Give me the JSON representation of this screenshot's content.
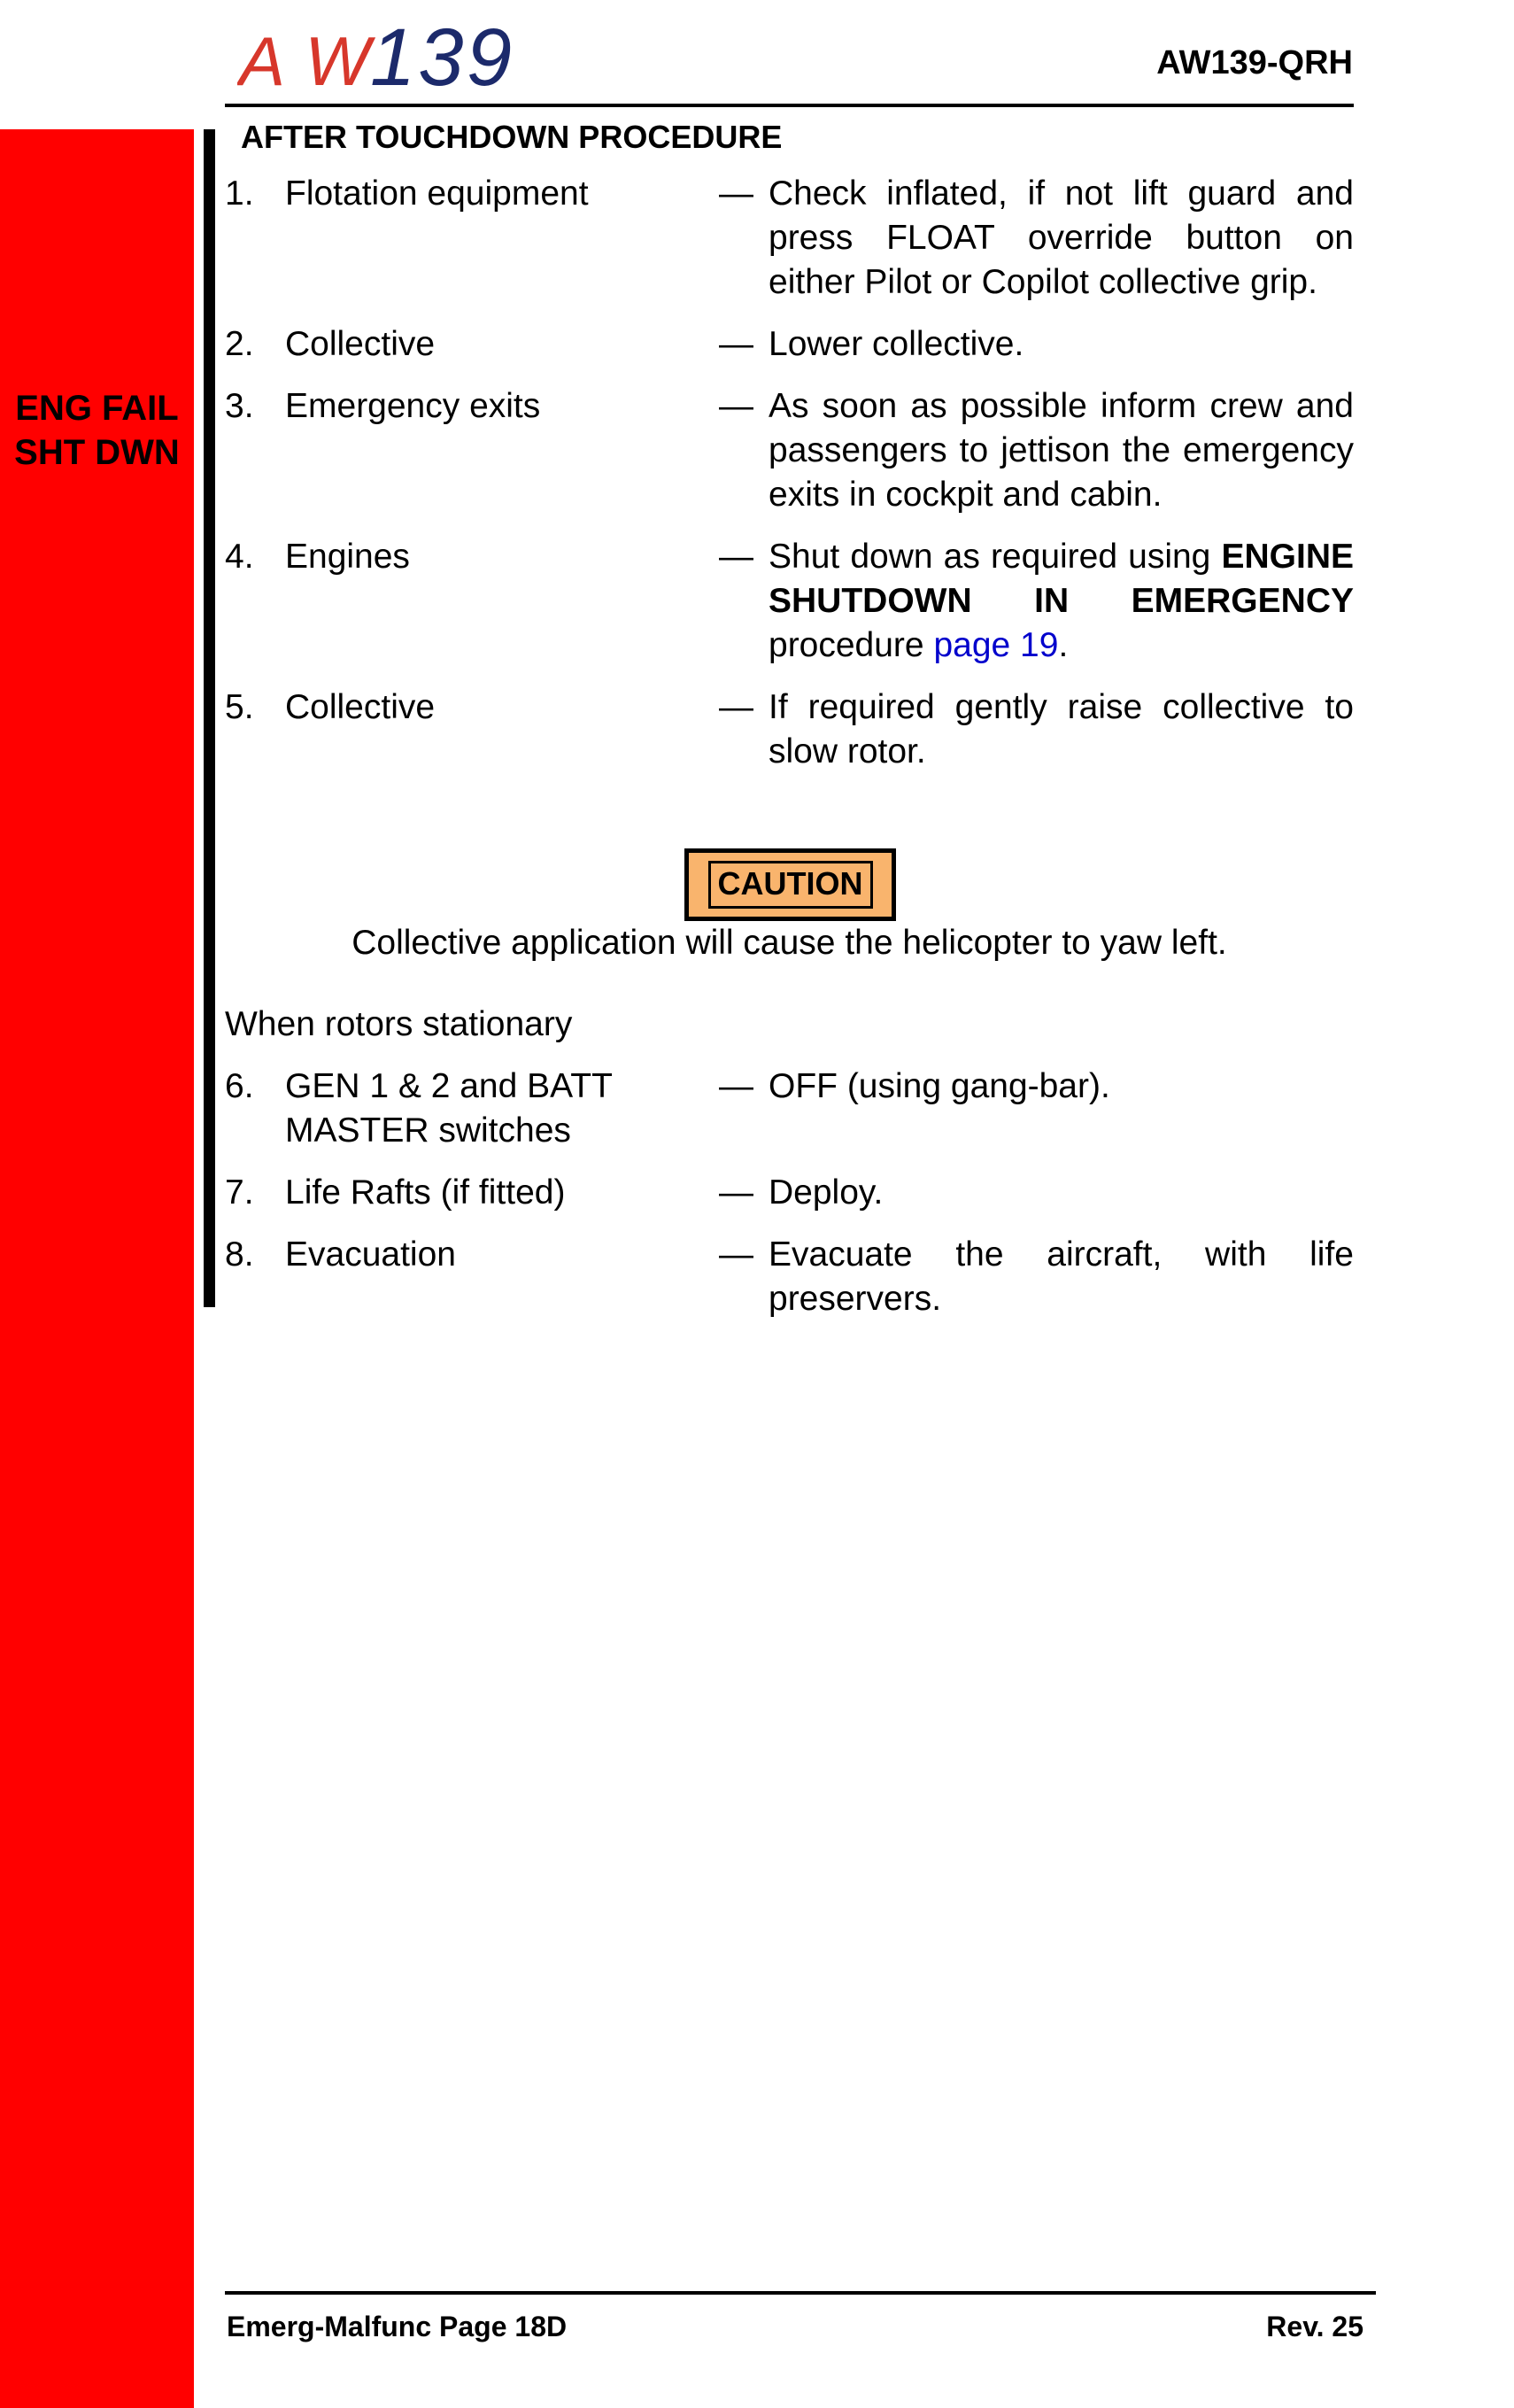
{
  "header": {
    "logo_text_aw": "AW",
    "logo_text_num": "139",
    "doc_code": "AW139-QRH"
  },
  "sidebar": {
    "tab_line1": "ENG FAIL",
    "tab_line2": "SHT DWN",
    "color": "#ff0000"
  },
  "section": {
    "title": "AFTER TOUCHDOWN PROCEDURE"
  },
  "steps": [
    {
      "num": "1.",
      "item": "Flotation equipment",
      "dash": "—",
      "action": "Check inflated, if not  lift guard and press FLOAT override button on either Pilot or Copilot collective grip."
    },
    {
      "num": "2.",
      "item": "Collective",
      "dash": "—",
      "action": "Lower collective."
    },
    {
      "num": "3.",
      "item": "Emergency exits",
      "dash": "—",
      "action": "As soon as possible inform crew and passengers to jettison the emergency exits in cockpit and cabin."
    },
    {
      "num": "4.",
      "item": "Engines",
      "dash": "—",
      "action_pre": "Shut down as required using ",
      "action_bold": "ENGINE SHUTDOWN IN EMERGENCY",
      "action_mid": " procedure ",
      "action_link": "page 19",
      "action_post": "."
    },
    {
      "num": "5.",
      "item": "Collective",
      "dash": "—",
      "action": "If required gently raise collective to slow rotor."
    }
  ],
  "caution": {
    "label": "CAUTION",
    "text": "Collective application will cause the helicopter to yaw left.",
    "color": "#f9b46d"
  },
  "sub_heading": "When rotors stationary",
  "steps2": [
    {
      "num": "6.",
      "item_line1": "GEN 1 & 2 and BATT",
      "item_line2": "MASTER switches",
      "dash": "—",
      "action": "OFF (using gang-bar)."
    },
    {
      "num": "7.",
      "item": "Life Rafts (if fitted)",
      "dash": "—",
      "action": "Deploy."
    },
    {
      "num": "8.",
      "item": "Evacuation",
      "dash": "—",
      "action": "Evacuate the aircraft, with life preservers."
    }
  ],
  "footer": {
    "left": "Emerg-Malfunc Page 18D",
    "right": "Rev. 25"
  }
}
